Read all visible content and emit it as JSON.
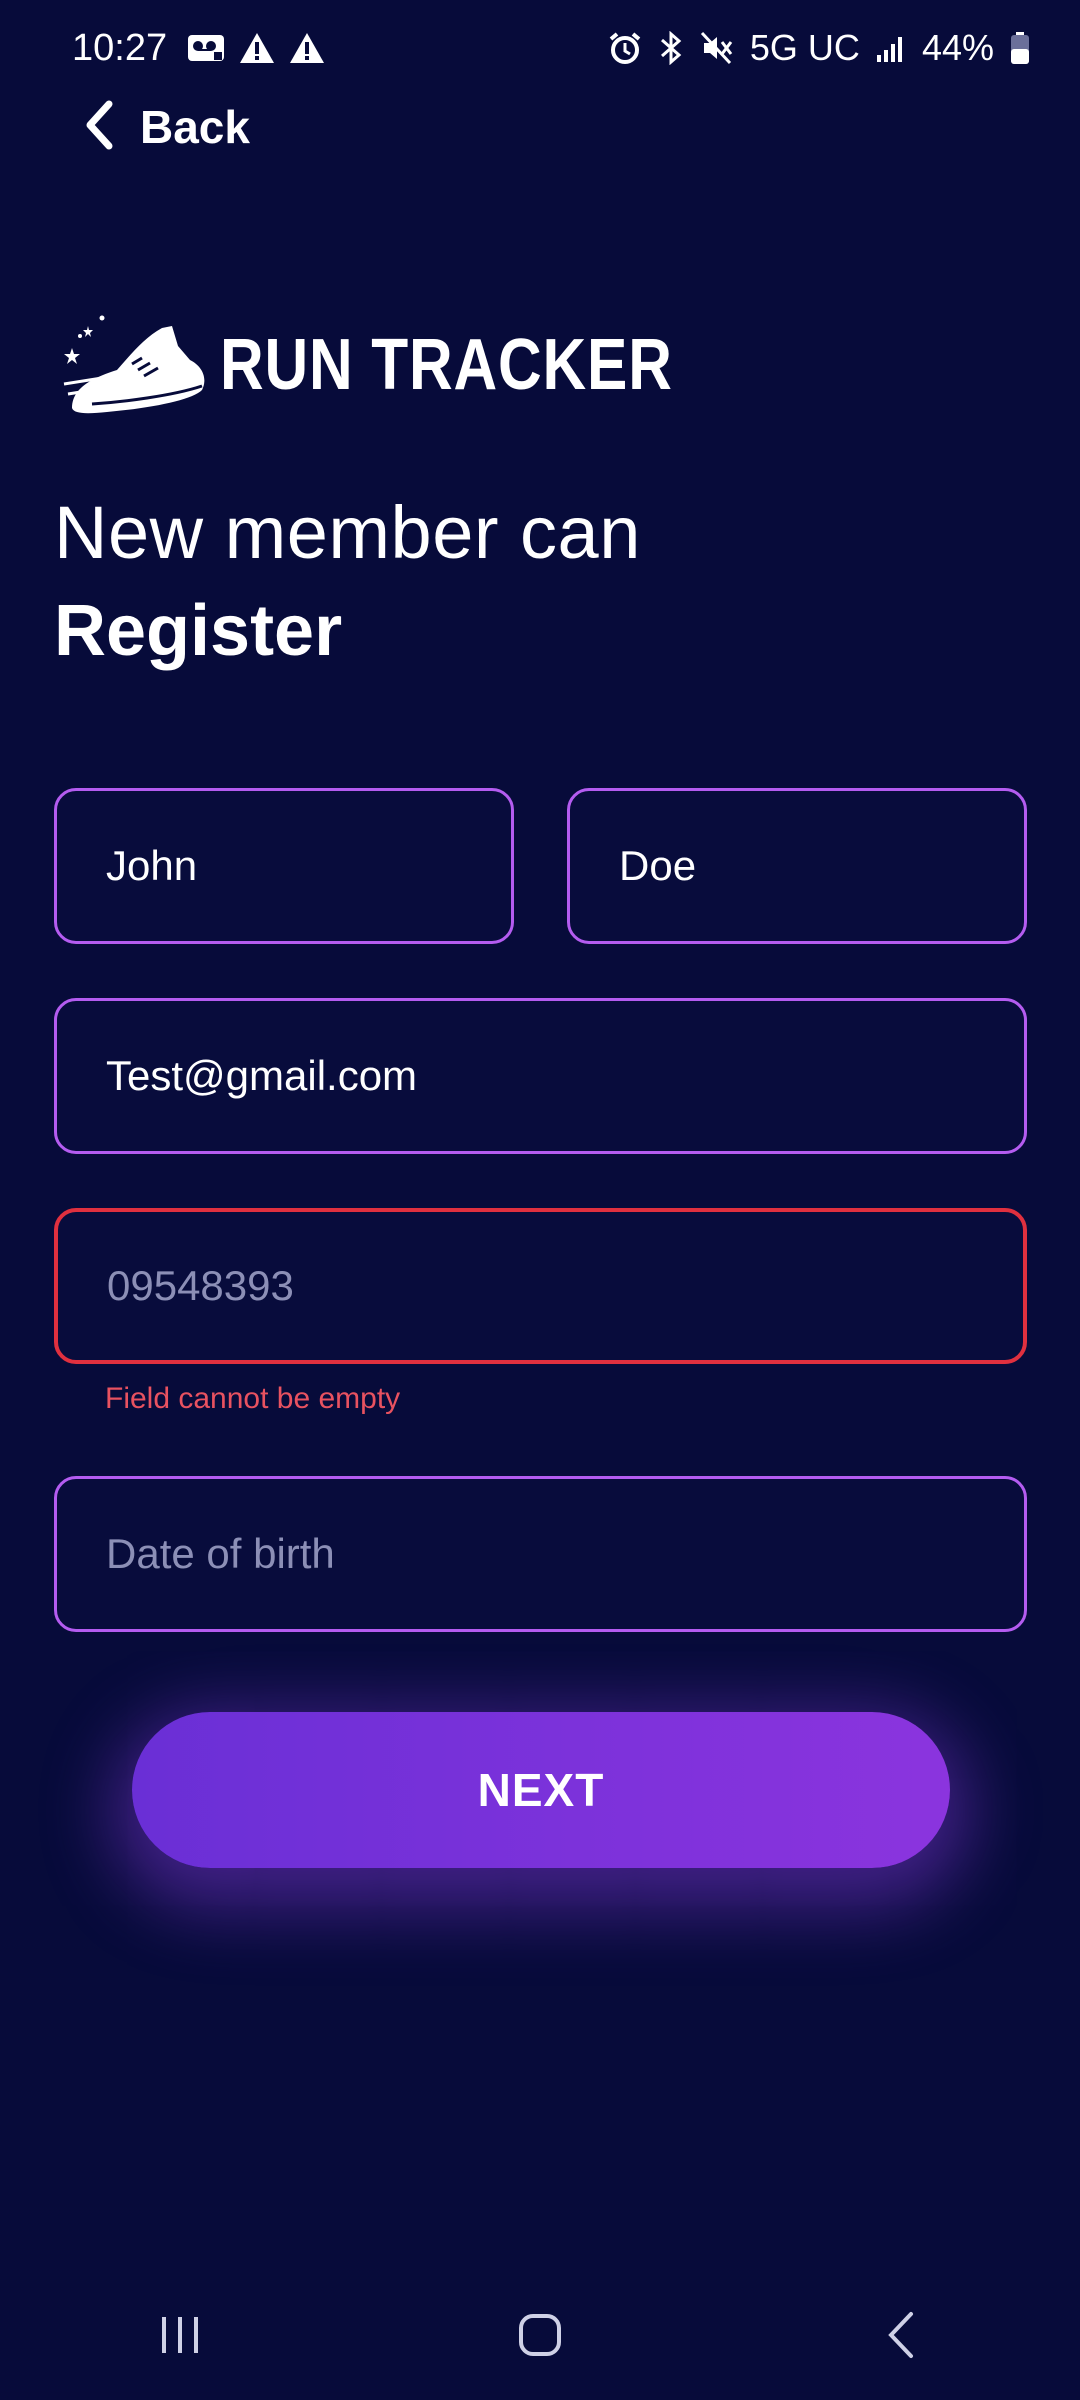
{
  "status_bar": {
    "time": "10:27",
    "left_icons": [
      "voicemail-icon",
      "warning-icon",
      "warning-icon"
    ],
    "right_icons": [
      "alarm-icon",
      "bluetooth-icon",
      "mute-icon"
    ],
    "network": "5G UC",
    "battery": "44%"
  },
  "nav": {
    "back_label": "Back"
  },
  "logo": {
    "text": "RUN TRACKER",
    "icon": "running-shoe-icon"
  },
  "heading": {
    "line1": "New member can",
    "line2": "Register"
  },
  "form": {
    "first_name": {
      "value": "John",
      "placeholder": ""
    },
    "last_name": {
      "value": "Doe",
      "placeholder": ""
    },
    "email": {
      "value": "Test@gmail.com",
      "placeholder": ""
    },
    "phone": {
      "value": "",
      "placeholder": "09548393",
      "error": "Field cannot be empty"
    },
    "dob": {
      "value": "",
      "placeholder": "Date of birth"
    }
  },
  "actions": {
    "next_label": "NEXT"
  },
  "colors": {
    "background": "#070b3a",
    "field_border": "#b45cf0",
    "error": "#e0303f",
    "button_start": "#6a2fd6",
    "button_end": "#8b34de"
  }
}
